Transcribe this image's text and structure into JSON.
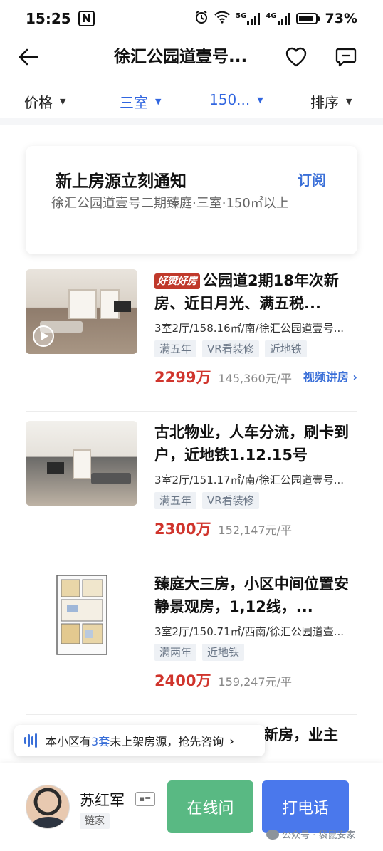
{
  "status_bar": {
    "time": "15:25",
    "nfc": "N",
    "net_5g": "5G",
    "net_4g": "4G",
    "battery": "73%"
  },
  "header": {
    "title": "徐汇公园道壹号..."
  },
  "filters": {
    "price": "价格",
    "rooms": "三室",
    "area": "150...",
    "sort": "排序"
  },
  "subscribe": {
    "title": "新上房源立刻通知",
    "action": "订阅",
    "desc": "徐汇公园道壹号二期臻庭·三室·150㎡以上"
  },
  "listings": [
    {
      "badge": "好赞好房",
      "title": "公园道2期18年次新房、近日月光、满五税...",
      "meta": "3室2厅/158.16㎡/南/徐汇公园道壹号...",
      "tags": [
        "满五年",
        "VR看装修",
        "近地铁"
      ],
      "price": "2299万",
      "unit_price": "145,360元/平",
      "video": "视频讲房 ›"
    },
    {
      "title": "古北物业，人车分流，刷卡到户，近地铁1.12.15号",
      "meta": "3室2厅/151.17㎡/南/徐汇公园道壹号...",
      "tags": [
        "满五年",
        "VR看装修"
      ],
      "price": "2300万",
      "unit_price": "152,147元/平"
    },
    {
      "title": "臻庭大三房，小区中间位置安静景观房，1,12线，...",
      "meta": "3室2厅/150.71㎡/西南/徐汇公园道壹...",
      "tags": [
        "满两年",
        "近地铁"
      ],
      "price": "2400万",
      "unit_price": "159,247元/平"
    }
  ],
  "partial_listing": {
    "title_fragment": "新房，业主"
  },
  "banner": {
    "prefix": "本小区有",
    "count": "3套",
    "suffix": "未上架房源，抢先咨询",
    "arrow": "›"
  },
  "agent": {
    "name": "苏红军",
    "company": "链家",
    "online_button": "在线问",
    "call_button": "打电话"
  },
  "watermark": "公众号 · 袋鼠安家"
}
